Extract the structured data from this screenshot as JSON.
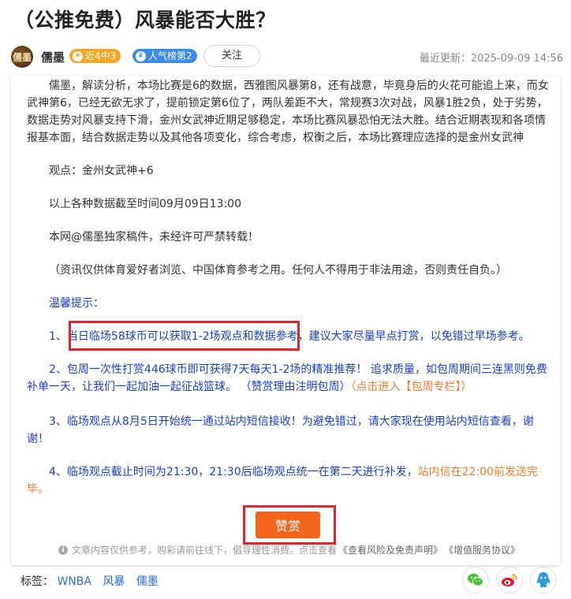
{
  "article": {
    "title": "（公推免费）风暴能否大胜？"
  },
  "author": {
    "avatar_text": "儒墨",
    "name": "儒墨",
    "badge_streak": "近4中3",
    "badge_rank": "人气榜第2",
    "follow_label": "关注",
    "update_time": "最近更新：2025-09-09 14:56"
  },
  "content": {
    "analysis": "儒墨，解读分析，本场比赛是6的数据，西雅图风暴第8，还有战意，毕竟身后的火花可能追上来，而女武神第6，已经无欲无求了，提前锁定第6位了，两队差距不大，常规赛3次对战，风暴1胜2负，处于劣势，数据走势对风暴支持下滑，金州女武神近期足够稳定，本场比赛风暴恐怕无法大胜。结合近期表现和各项情报基本面，结合数据走势以及其他各项变化，综合考虑，权衡之后，本场比赛理应选择的是金州女武神",
    "view": "观点：金州女武神+6",
    "cutoff": "以上各种数据截至时间09月09日13:00",
    "copyright": "本网@儒墨独家稿件，未经许可严禁转载！",
    "disclaimer": "（资讯仅供体育爱好者浏览、中国体育参考之用。任何人不得用于非法用途，否则责任自负。）",
    "tips_title": "温馨提示：",
    "tip1_prefix": "1、",
    "tip1_highlight": "当日临场58球币可以获取1-2场观点和数据参考",
    "tip1_suffix": "，建议大家尽量早点打赏，以免错过早场参考。",
    "tip2_text": "2、包周一次性打赏446球币即可获得7天每天1-2场的精准推荐！ 追求质量，如包周期间三连黑则免费补单一天，让我们一起加油一起征战篮球。 （赞赏理由注明包周）",
    "tip2_link": "（点击进入【包周专栏】）",
    "tip3": "3、临场观点从8月5日开始统一通过站内短信接收！为避免错过，请大家现在使用站内短信查看，谢谢！",
    "tip4_text": "4、临场观点截止时间为21:30，21:30后临场观点统一在第二天进行补发，",
    "tip4_orange": "站内信在22:00前发送完毕。"
  },
  "reward": {
    "label": "赞赏"
  },
  "footnote": {
    "text": "文章内容仅供参考，购彩请前往线下，倡导理性消费。点击查看",
    "link_risk": "《查看风险及免责声明》",
    "link_service": "《增值服务协议》"
  },
  "tags": {
    "label": "标签：",
    "items": [
      "WNBA",
      "风暴",
      "儒墨"
    ]
  },
  "share": {
    "icons": [
      "wechat-icon",
      "weibo-icon",
      "qq-icon"
    ]
  },
  "colors": {
    "accent_orange": "#f2651a",
    "highlight_red": "#e3232a",
    "tip_blue": "#1a3fc9",
    "badge_orange": "#f5a623",
    "badge_blue": "#3b8bea",
    "wechat_green": "#4cbf3b",
    "weibo_red": "#e6162d",
    "qq_blue": "#2c9ad9"
  }
}
